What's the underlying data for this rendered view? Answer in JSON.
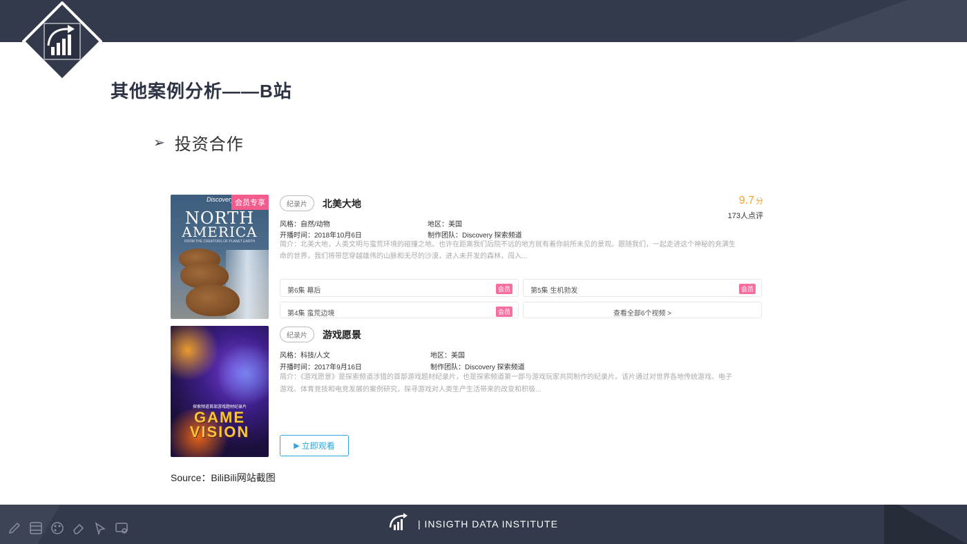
{
  "slide": {
    "title": "其他案例分析——B站",
    "bullet_text": "投资合作",
    "source": "Source：BiliBili网站截图"
  },
  "card1": {
    "poster": {
      "vip_tag": "会员专享",
      "brand": "Discovery",
      "title_line1": "NORTH",
      "title_line2": "AMERICA",
      "subtitle": "FROM THE CREATORS OF PLANET EARTH"
    },
    "type_tag": "纪录片",
    "title": "北美大地",
    "score": "9.7",
    "score_unit": "分",
    "rating_count": "173人点评",
    "genre": "风格：自然/动物",
    "region": "地区：美国",
    "date": "开播时间：2018年10月6日",
    "team": "制作团队：Discovery 探索频道",
    "desc_line1": "简介：北美大地，人类文明与蛮荒环境的碰撞之地。也许在距离我们后院不远的地方就有着你前所未见的景观。跟随我们，一起走进这个神秘的充满生",
    "desc_line2": "命的世界，我们将带您穿越雄伟的山脉和无尽的沙漠，进入未开发的森林，闯入...",
    "episodes": [
      {
        "label": "第6集 幕后",
        "vip": "会员"
      },
      {
        "label": "第5集 生机勃发",
        "vip": "会员"
      },
      {
        "label": "第4集 蛮荒边境",
        "vip": "会员"
      }
    ],
    "view_all": "查看全部6个视频 >"
  },
  "card2": {
    "poster": {
      "line1": "探索频道首部游戏题材纪录片",
      "title_line1": "GAME",
      "title_line2": "VISION"
    },
    "type_tag": "纪录片",
    "title": "游戏愿景",
    "genre": "风格：科技/人文",
    "region": "地区：美国",
    "date": "开播时间：2017年9月16日",
    "team": "制作团队：Discovery 探索频道",
    "desc_line1": "简介：《游戏愿景》是探索频道涉猎的首部游戏题材纪录片，也是探索频道第一部与游戏玩家共同制作的纪录片。该片通过对世界各地传统游戏、电子",
    "desc_line2": "游戏、体育竞技和电竞发展的案例研究，探寻游戏对人类生产生活带来的改变和积极...",
    "watch_label": "立即观看"
  },
  "footer": {
    "text": "| INSIGTH DATA INSTITUTE"
  },
  "toolbar_icons": [
    "pen-icon",
    "slides-icon",
    "palette-icon",
    "eraser-icon",
    "pointer-icon",
    "screen-icon"
  ],
  "colors": {
    "bar": "#333a4b",
    "score": "#ff9d2d",
    "vip": "#f25d8e",
    "watch": "#2fa5e0"
  }
}
